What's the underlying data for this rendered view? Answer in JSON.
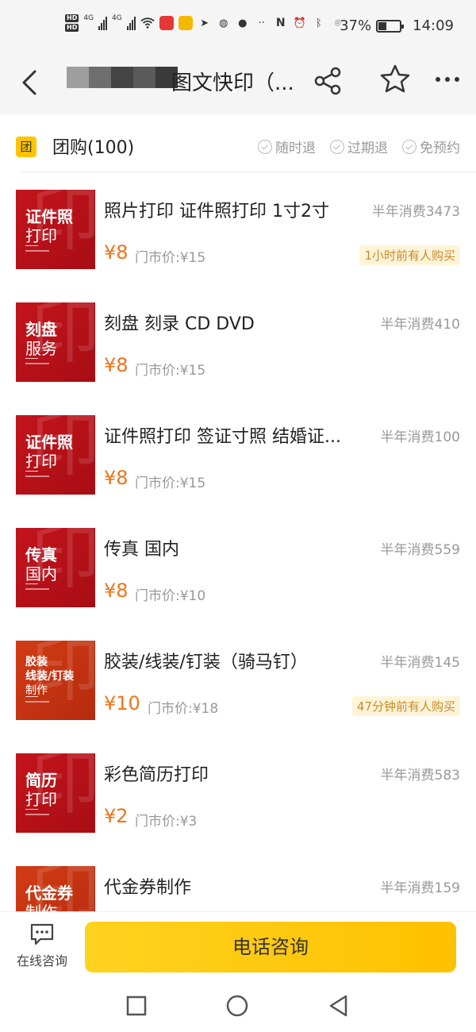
{
  "status_bar": {
    "hd1": "HD",
    "hd2": "HD",
    "net1": "4G",
    "net2": "4G",
    "battery_percent": "37%",
    "battery_level": 0.37,
    "time": "14:09"
  },
  "navbar": {
    "title": "图文快印（..."
  },
  "group": {
    "badge": "团",
    "title": "团购(100)",
    "guarantees": [
      "随时退",
      "过期退",
      "免预约"
    ]
  },
  "deals": [
    {
      "name": "照片打印 证件照打印 1寸2寸",
      "sales": "半年消费3473",
      "price": "¥8",
      "orig": "门市价:¥15",
      "recent": "1小时前有人购买",
      "thumb": [
        "证件照",
        "打印"
      ]
    },
    {
      "name": "刻盘 刻录 CD DVD",
      "sales": "半年消费410",
      "price": "¥8",
      "orig": "门市价:¥15",
      "recent": "",
      "thumb": [
        "刻盘",
        "服务"
      ]
    },
    {
      "name": "证件照打印 签证寸照 结婚证...",
      "sales": "半年消费100",
      "price": "¥8",
      "orig": "门市价:¥15",
      "recent": "",
      "thumb": [
        "证件照",
        "打印"
      ]
    },
    {
      "name": "传真 国内",
      "sales": "半年消费559",
      "price": "¥8",
      "orig": "门市价:¥10",
      "recent": "",
      "thumb": [
        "传真",
        "国内"
      ]
    },
    {
      "name": "胶装/线装/钉装（骑马钉）",
      "sales": "半年消费145",
      "price": "¥10",
      "orig": "门市价:¥18",
      "recent": "47分钟前有人购买",
      "thumb": [
        "胶装",
        "线装/钉装",
        "制作"
      ]
    },
    {
      "name": "彩色简历打印",
      "sales": "半年消费583",
      "price": "¥2",
      "orig": "门市价:¥3",
      "recent": "",
      "thumb": [
        "简历",
        "打印"
      ]
    },
    {
      "name": "代金券制作",
      "sales": "半年消费159",
      "price": "",
      "orig": "",
      "recent": "",
      "thumb": [
        "代金券",
        "制作"
      ]
    }
  ],
  "bottom": {
    "chat_label": "在线咨询",
    "call_label": "电话咨询"
  },
  "colors": {
    "accent": "#ffc400",
    "price": "#f0731a",
    "thumb_red": "#c4141c",
    "thumb_orange": "#d23c15"
  }
}
